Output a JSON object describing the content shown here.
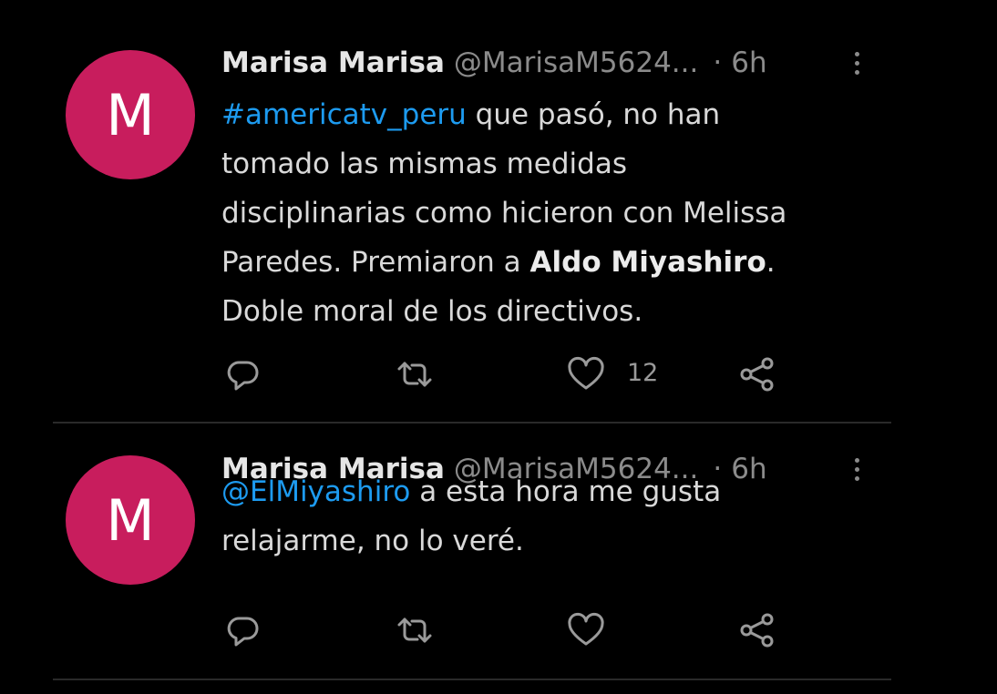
{
  "tweets": [
    {
      "avatar_letter": "M",
      "name": "Marisa Marisa",
      "handle": "@MarisaM5624...",
      "separator": "·",
      "time": "6h",
      "text": {
        "hashtag": "#americatv_peru",
        "part1": " que pasó, no han\ntomado las mismas medidas\ndisciplinarias como hicieron con Melissa\nParedes. Premiaron a ",
        "bold": "Aldo Miyashiro",
        "part2": ".\nDoble moral de los directivos."
      },
      "like_count": "12"
    },
    {
      "avatar_letter": "M",
      "name": "Marisa Marisa",
      "handle": "@MarisaM5624...",
      "separator": "·",
      "time": "6h",
      "text": {
        "mention": "@ElMiyashiro",
        "part1": " a esta hora me gusta\nrelajarme, no lo veré."
      },
      "like_count": ""
    }
  ],
  "icons": [
    "reply-icon",
    "retweet-icon",
    "like-icon",
    "share-icon",
    "more-icon"
  ],
  "colors": {
    "background": "#000000",
    "avatar": "#c81d5d",
    "link": "#1d9bf0",
    "muted": "#8b8b8b"
  }
}
